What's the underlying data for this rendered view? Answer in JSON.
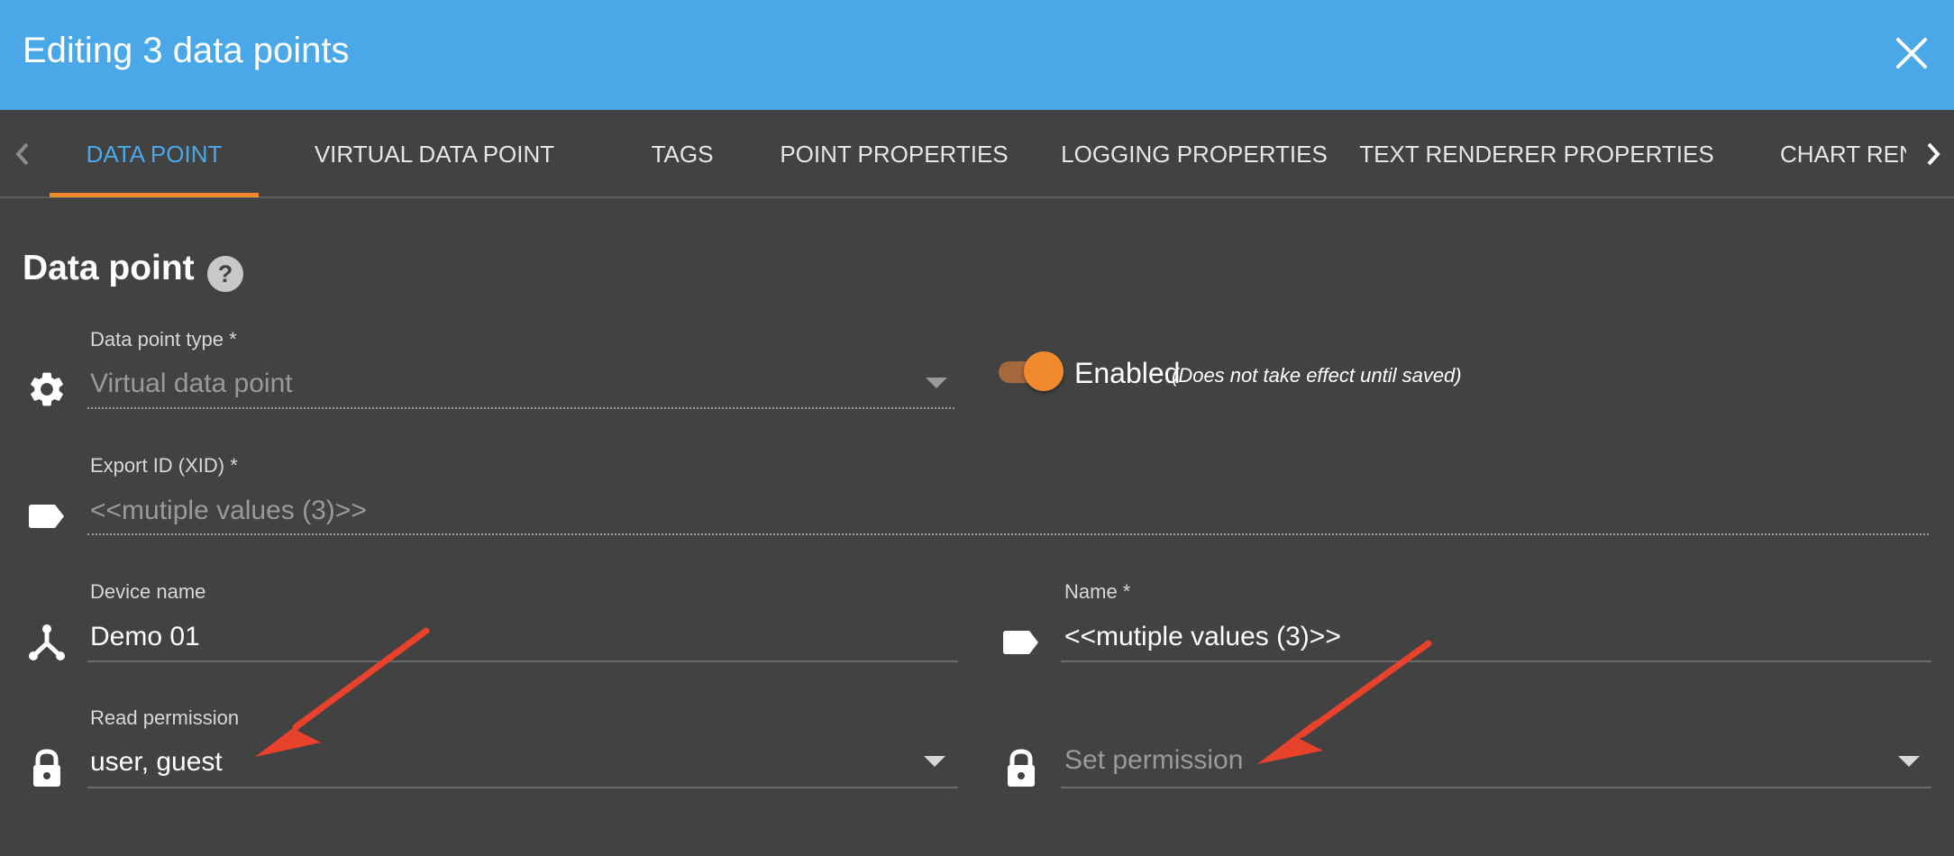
{
  "dialog": {
    "title": "Editing 3 data points",
    "close_icon": "close-icon"
  },
  "tabs": [
    {
      "label": "DATA POINT",
      "active": true
    },
    {
      "label": "VIRTUAL DATA POINT",
      "active": false
    },
    {
      "label": "TAGS",
      "active": false
    },
    {
      "label": "POINT PROPERTIES",
      "active": false
    },
    {
      "label": "LOGGING PROPERTIES",
      "active": false
    },
    {
      "label": "TEXT RENDERER PROPERTIES",
      "active": false
    },
    {
      "label": "CHART RENDERER",
      "active": false
    }
  ],
  "section": {
    "title": "Data point",
    "help_icon": "help-circle-icon"
  },
  "fields": {
    "data_point_type": {
      "label": "Data point type *",
      "value": "Virtual data point",
      "icon": "gear-icon"
    },
    "enabled": {
      "label": "Enabled",
      "note": "(Does not take effect until saved)",
      "on": true
    },
    "export_id": {
      "label": "Export ID (XID) *",
      "value": "<<mutiple values (3)>>",
      "icon": "tag-icon"
    },
    "device_name": {
      "label": "Device name",
      "value": "Demo 01",
      "icon": "device-hierarchy-icon"
    },
    "name": {
      "label": "Name *",
      "value": "<<mutiple values (3)>>",
      "icon": "tag-icon"
    },
    "read_permission": {
      "label": "Read permission",
      "value": "user, guest",
      "icon": "lock-icon"
    },
    "set_permission": {
      "placeholder": "Set permission",
      "icon": "lock-icon"
    }
  },
  "colors": {
    "header": "#4aa8e8",
    "background": "#424242",
    "accent": "#f08a2c",
    "annotation_arrow": "#e8412c"
  }
}
